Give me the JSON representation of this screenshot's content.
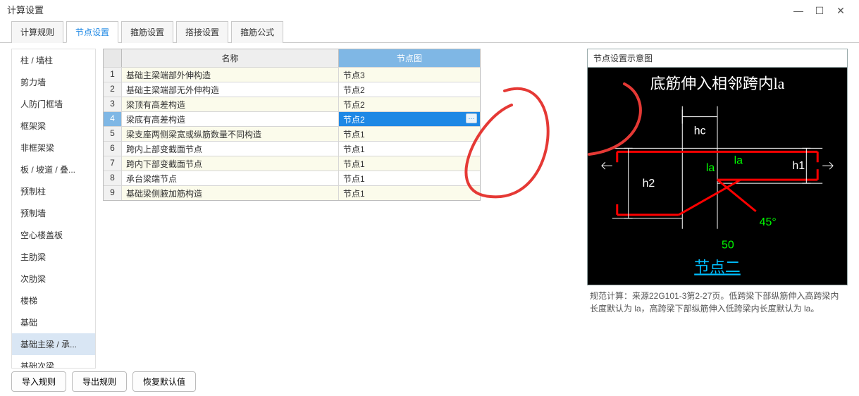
{
  "window": {
    "title": "计算设置"
  },
  "tabs": [
    {
      "label": "计算规则"
    },
    {
      "label": "节点设置"
    },
    {
      "label": "箍筋设置"
    },
    {
      "label": "搭接设置"
    },
    {
      "label": "箍筋公式"
    }
  ],
  "sidebar": {
    "items": [
      {
        "label": "柱 / 墙柱"
      },
      {
        "label": "剪力墙"
      },
      {
        "label": "人防门框墙"
      },
      {
        "label": "框架梁"
      },
      {
        "label": "非框架梁"
      },
      {
        "label": "板 / 坡道 / 叠..."
      },
      {
        "label": "预制柱"
      },
      {
        "label": "预制墙"
      },
      {
        "label": "空心楼盖板"
      },
      {
        "label": "主肋梁"
      },
      {
        "label": "次肋梁"
      },
      {
        "label": "楼梯"
      },
      {
        "label": "基础"
      },
      {
        "label": "基础主梁 / 承..."
      },
      {
        "label": "基础次梁"
      }
    ]
  },
  "table": {
    "headers": {
      "name": "名称",
      "node": "节点图"
    },
    "rows": [
      {
        "idx": "1",
        "name": "基础主梁端部外伸构造",
        "node": "节点3"
      },
      {
        "idx": "2",
        "name": "基础主梁端部无外伸构造",
        "node": "节点2"
      },
      {
        "idx": "3",
        "name": "梁顶有高差构造",
        "node": "节点2"
      },
      {
        "idx": "4",
        "name": "梁底有高差构造",
        "node": "节点2"
      },
      {
        "idx": "5",
        "name": "梁支座两侧梁宽或纵筋数量不同构造",
        "node": "节点1"
      },
      {
        "idx": "6",
        "name": "跨内上部变截面节点",
        "node": "节点1"
      },
      {
        "idx": "7",
        "name": "跨内下部变截面节点",
        "node": "节点1"
      },
      {
        "idx": "8",
        "name": "承台梁端节点",
        "node": "节点1"
      },
      {
        "idx": "9",
        "name": "基础梁侧腋加筋构造",
        "node": "节点1"
      }
    ]
  },
  "diagram": {
    "title": "节点设置示意图",
    "heading": "底筋伸入相邻跨内la",
    "labels": {
      "hc": "hc",
      "la_left": "la",
      "la_right": "la",
      "h1": "h1",
      "h2": "h2",
      "angle": "45°",
      "fifty": "50",
      "node_name": "节点二"
    },
    "description": "规范计算：来源22G101-3第2-27页。低跨梁下部纵筋伸入高跨梁内长度默认为 la，高跨梁下部纵筋伸入低跨梁内长度默认为 la。"
  },
  "buttons": {
    "import": "导入规则",
    "export": "导出规则",
    "reset": "恢复默认值"
  }
}
